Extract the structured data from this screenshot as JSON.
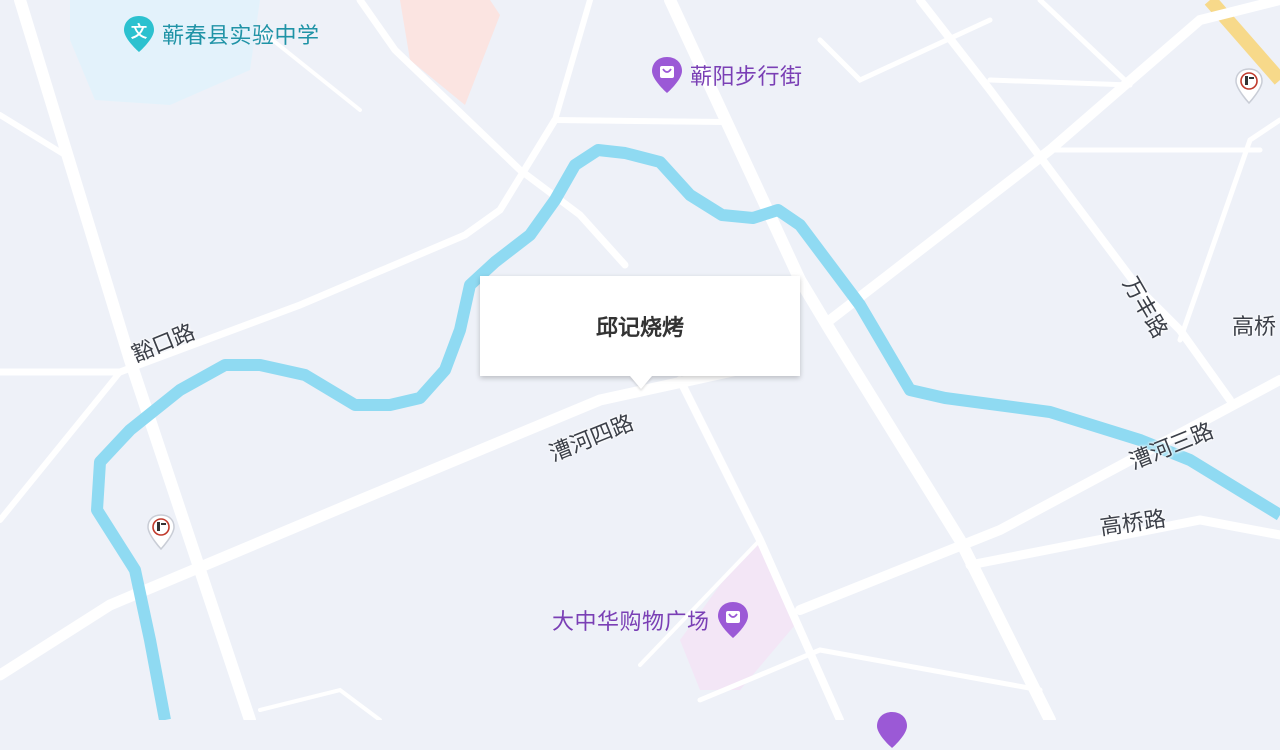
{
  "map": {
    "colors": {
      "background": "#eef1f8",
      "road": "#ffffff",
      "river": "#8fdaf2",
      "highway": "#f7d98a",
      "school_area": "#e3f2fb",
      "commercial_area": "#f3e6f6",
      "salmon_area": "#fbe4e1"
    }
  },
  "pois": {
    "school": {
      "name": "蕲春县实验中学",
      "icon": "school-icon",
      "color": "#1f93a6"
    },
    "pedestrian_street": {
      "name": "蕲阳步行街",
      "icon": "shopping-bag-icon",
      "color": "#7a3fb5"
    },
    "mall": {
      "name": "大中华购物广场",
      "icon": "shopping-bag-icon",
      "color": "#7a3fb5"
    }
  },
  "roads": {
    "r1": "豁口路",
    "r2": "漕河四路",
    "r3": "漕河三路",
    "r4": "万丰路",
    "r5": "高桥路",
    "r6": "高桥"
  },
  "popup": {
    "title": "邱记烧烤"
  },
  "gas_stations": {
    "icon": "sinopec-gas-station-icon"
  }
}
